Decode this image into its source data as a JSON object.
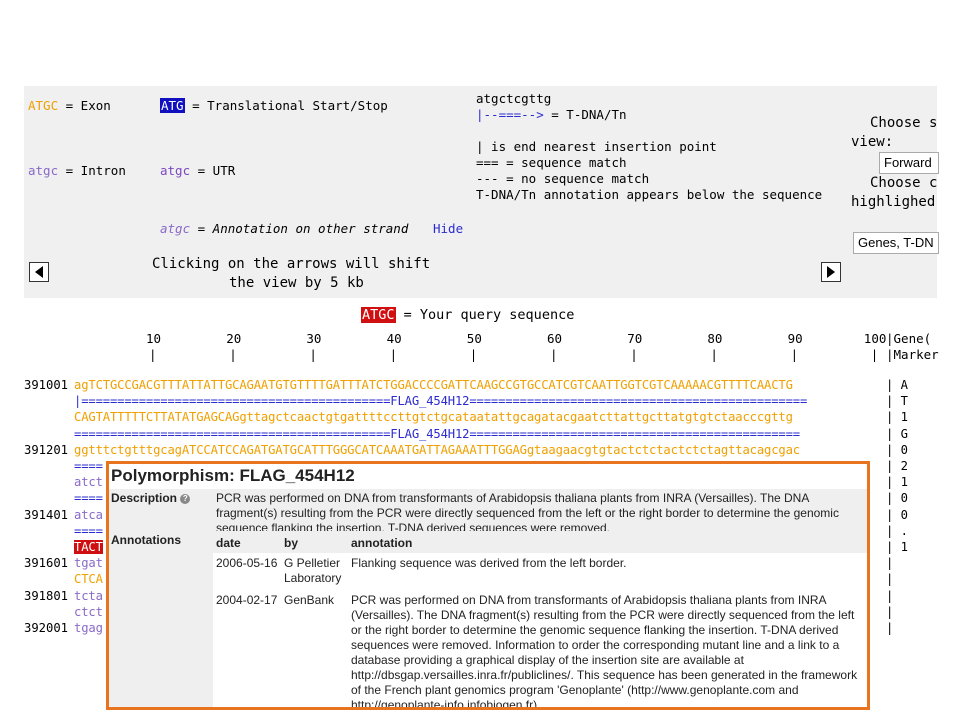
{
  "legend": {
    "exon_sample": "ATGC",
    "exon_label": " = Exon",
    "start_sample": "ATG",
    "start_label": " = Translational Start/Stop",
    "tdna_sample": "atgctcgttg",
    "tdna_arrow": "|--===-->",
    "tdna_label": " = T-DNA/Tn",
    "intron_sample": "atgc",
    "intron_label": " = Intron",
    "utr_sample": "atgc",
    "utr_label": " = UTR",
    "end_line": "| is end nearest insertion point",
    "match_line": "=== = sequence match",
    "nomatch_line": "--- = no sequence match",
    "annot_line": "T-DNA/Tn annotation appears below the sequence",
    "other_strand_sample": "atgc",
    "other_strand_label": " = Annotation on other strand ",
    "hide_link": "Hide",
    "shift_text_1": "Clicking on the arrows will shift",
    "shift_text_2": "the view by 5 kb",
    "choose_view_1": "Choose s",
    "choose_view_2": "view:",
    "view_select": "Forward",
    "choose_hl_1": "Choose c",
    "choose_hl_2": "highlighed",
    "hl_select": "Genes, T-DN"
  },
  "query": {
    "sample": "ATGC",
    "label": " = Your query sequence"
  },
  "ruler": {
    "ticks": [
      "10",
      "20",
      "30",
      "40",
      "50",
      "60",
      "70",
      "80",
      "90",
      "100"
    ],
    "gene_header_1": "Gene(",
    "gene_header_2": "Marker"
  },
  "sequence": {
    "positions": [
      "391001",
      "391201",
      "391401",
      "391601",
      "391801",
      "392001"
    ],
    "lines": [
      {
        "text": "agTCTGCCGACGTTTATTATTGCAGAATGTGTTTTGATTTATCTGGACCCCGATTCAAGCCGTGCCATCGTCAATTGGTCGTCAAAAACGTTTTCAACTG",
        "cls": "exon"
      },
      {
        "text": "|===========================================FLAG_454H12===============================================",
        "cls": "blue"
      },
      {
        "text": "CAGTATTTTTCTTATATGAGCAGgttagctcaactgtgattttccttgtctgcataatattgcagatacgaatcttattgcttatgtgtctaacccgttg",
        "cls": "exon"
      },
      {
        "text": "============================================FLAG_454H12==============================================",
        "cls": "blue"
      },
      {
        "text": "ggtttctgtttgcagATCCATCCAGATGATGCATTTGGGCATCAAATGATTAGAAATTTGGAGgtaagaacgtgtactctctactctctagttacagcgac",
        "cls": "exon"
      },
      {
        "text": "====",
        "cls": "blue"
      },
      {
        "text": "atct",
        "cls": "intron"
      },
      {
        "text": "====",
        "cls": "blue"
      },
      {
        "text": "atca",
        "cls": "intron"
      },
      {
        "text": "====",
        "cls": "blue"
      },
      {
        "text": "TACT",
        "cls": "query"
      },
      {
        "text": "tgat",
        "cls": "intron"
      },
      {
        "text": "CTCA",
        "cls": "exon"
      },
      {
        "text": "tcta",
        "cls": "intron"
      },
      {
        "text": "ctct",
        "cls": "intron"
      },
      {
        "text": "tgag",
        "cls": "intron"
      }
    ],
    "right_column": [
      "| A",
      "| T",
      "| 1",
      "| G",
      "| 0",
      "| 2",
      "| 1",
      "| 0",
      "| 0",
      "| .",
      "| 1",
      "|",
      "|",
      "|",
      "|",
      "|"
    ]
  },
  "popup": {
    "title": "Polymorphism: FLAG_454H12",
    "description_label": "Description",
    "description_text": "PCR was performed on DNA from transformants of Arabidopsis thaliana plants from INRA (Versailles). The DNA fragment(s) resulting from the PCR were directly sequenced from the left or the right border to determine the genomic sequence flanking the insertion. T-DNA derived sequences were removed.",
    "annotations_label": "Annotations",
    "columns": [
      "date",
      "by",
      "annotation"
    ],
    "rows": [
      {
        "date": "2006-05-16",
        "by": "G Pelletier Laboratory",
        "annotation": "Flanking sequence was derived from the left border."
      },
      {
        "date": "2004-02-17",
        "by": "GenBank",
        "annotation": "PCR was performed on DNA from transformants of Arabidopsis thaliana plants from INRA (Versailles). The DNA fragment(s) resulting from the PCR were directly sequenced from the left or the right border to determine the genomic sequence flanking the insertion. T-DNA derived sequences were removed. Information to order the corresponding mutant line and a link to a database providing a graphical display of the insertion site are available at http://dbsgap.versailles.inra.fr/publiclines/. This sequence has been generated in the framework of the French plant genomics program 'Genoplante' (http://www.genoplante.com and http://genoplante-info.infobiogen.fr)."
      }
    ]
  },
  "colors": {
    "exon": "#f0a000",
    "intron": "#8a6ac8",
    "start": "#1010c0",
    "query": "#d01010",
    "popup_border": "#e87420"
  }
}
